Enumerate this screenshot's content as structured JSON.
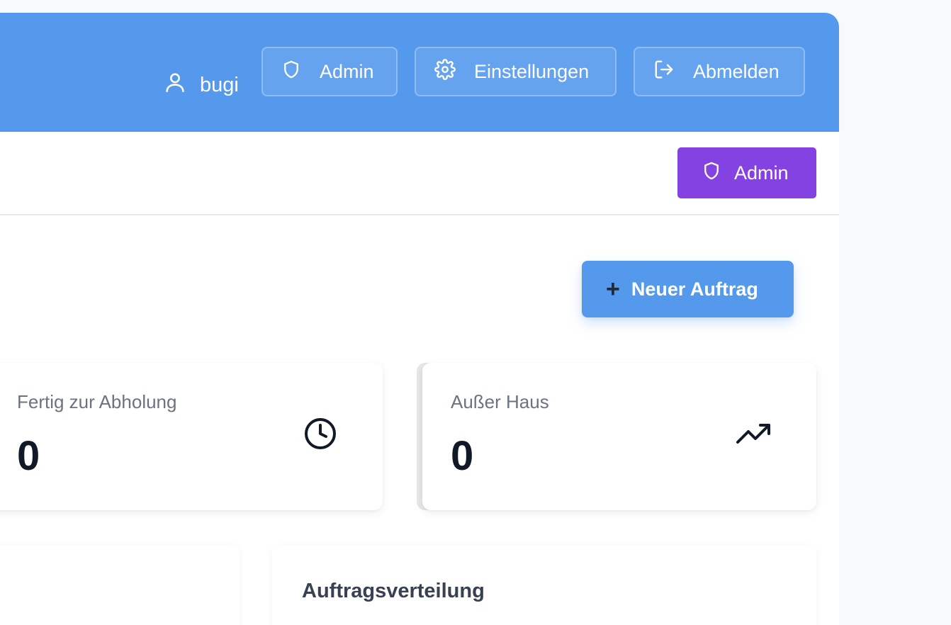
{
  "header": {
    "username": "bugi",
    "admin_label": "Admin",
    "settings_label": "Einstellungen",
    "logout_label": "Abmelden"
  },
  "subbar": {
    "admin_label": "Admin"
  },
  "actions": {
    "new_order_label": "Neuer Auftrag"
  },
  "stats": [
    {
      "label": "Fertig zur Abholung",
      "value": "0",
      "icon": "clock-icon"
    },
    {
      "label": "Außer Haus",
      "value": "0",
      "icon": "trending-up-icon"
    }
  ],
  "panels": {
    "distribution_title": "Auftragsverteilung"
  },
  "colors": {
    "header_bg": "#5599ec",
    "admin_purple": "#8542e3",
    "primary_button": "#5599ec"
  }
}
